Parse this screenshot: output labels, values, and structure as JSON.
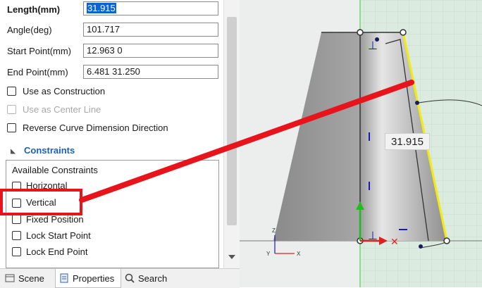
{
  "properties": {
    "length": {
      "label": "Length(mm)",
      "value": "31.915"
    },
    "angle": {
      "label": "Angle(deg)",
      "value": "101.717"
    },
    "start_point": {
      "label": "Start Point(mm)",
      "value": "12.963 0"
    },
    "end_point": {
      "label": "End Point(mm)",
      "value": "6.481 31.250"
    },
    "use_as_construction": "Use as Construction",
    "use_as_center_line": "Use as Center Line",
    "reverse_dimension": "Reverse Curve Dimension Direction"
  },
  "constraints": {
    "title": "Constraints",
    "available_label": "Available Constraints",
    "items": [
      "Horizontal",
      "Vertical",
      "Fixed Position",
      "Lock Start Point",
      "Lock End Point"
    ]
  },
  "tabs": [
    "Scene",
    "Properties",
    "Search"
  ],
  "active_tab": "Properties",
  "viewport": {
    "dimension_label": "31.915",
    "axis_labels": {
      "x": "X",
      "y": "Y",
      "z": "Z"
    }
  },
  "colors": {
    "accent": "#0a64d6",
    "highlight_red": "#e8141c",
    "selected_edge": "#f2ea10",
    "section_title": "#1f5fb0"
  }
}
